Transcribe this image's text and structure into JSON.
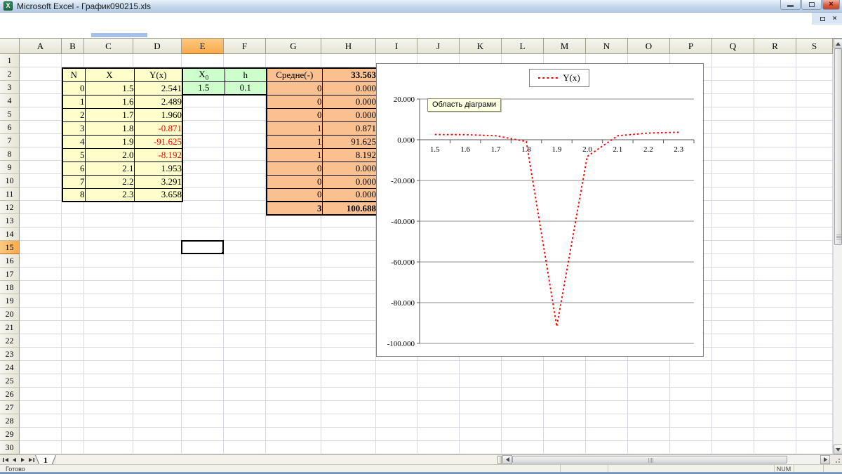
{
  "window": {
    "title": "Microsoft Excel - График090215.xls",
    "controls": {
      "minimize": "minimize",
      "restore": "restore",
      "close": "×"
    },
    "doc_controls": {
      "restore": "restore",
      "close": "×"
    }
  },
  "sheet": {
    "columns": [
      "A",
      "B",
      "C",
      "D",
      "E",
      "F",
      "G",
      "H",
      "I",
      "J",
      "K",
      "L",
      "M",
      "N",
      "O",
      "P",
      "Q",
      "R",
      "S"
    ],
    "row_count": 30,
    "selected_column": "E",
    "selected_row": 15,
    "active_cell": "E15"
  },
  "tables": {
    "main": {
      "headers": [
        "N",
        "X",
        "Y(x)"
      ],
      "rows": [
        [
          "0",
          "1.5",
          "2.541"
        ],
        [
          "1",
          "1.6",
          "2.489"
        ],
        [
          "2",
          "1.7",
          "1.960"
        ],
        [
          "3",
          "1.8",
          "-0.871"
        ],
        [
          "4",
          "1.9",
          "-91.625"
        ],
        [
          "5",
          "2.0",
          "-8.192"
        ],
        [
          "6",
          "2.1",
          "1.953"
        ],
        [
          "7",
          "2.2",
          "3.291"
        ],
        [
          "8",
          "2.3",
          "3.658"
        ]
      ]
    },
    "params": {
      "headers": [
        {
          "text": "X",
          "sub": "0"
        },
        {
          "text": "h",
          "sub": ""
        }
      ],
      "values": [
        "1.5",
        "0.1"
      ]
    },
    "summary": {
      "header": "Средне(-)",
      "header_value": "33.563",
      "rows": [
        [
          "0",
          "0.000"
        ],
        [
          "0",
          "0.000"
        ],
        [
          "0",
          "0.000"
        ],
        [
          "1",
          "0.871"
        ],
        [
          "1",
          "91.625"
        ],
        [
          "1",
          "8.192"
        ],
        [
          "0",
          "0.000"
        ],
        [
          "0",
          "0.000"
        ],
        [
          "0",
          "0.000"
        ]
      ],
      "total": [
        "3",
        "100.688"
      ]
    }
  },
  "chart_data": {
    "type": "line",
    "categories": [
      "1.5",
      "1.6",
      "1.7",
      "1.8",
      "1.9",
      "2.0",
      "2.1",
      "2.2",
      "2.3"
    ],
    "series": [
      {
        "name": "Y(x)",
        "values": [
          2.541,
          2.489,
          1.96,
          -0.871,
          -91.625,
          -8.192,
          1.953,
          3.291,
          3.658
        ],
        "color": "#FF0000",
        "style": "dotted"
      }
    ],
    "ylim": [
      -100,
      20
    ],
    "ytick_step": 20,
    "ytick_labels": [
      "20.000",
      "0.000",
      "-20.000",
      "-40.000",
      "-60.000",
      "-80.000",
      "-100.000"
    ],
    "grid": true,
    "legend": {
      "label": "Y(x)",
      "position": "top"
    },
    "tooltip": "Область діаграми"
  },
  "tab_bar": {
    "tabs": [
      "1"
    ],
    "active_tab": "1"
  },
  "status_bar": {
    "ready": "Готово",
    "num": "NUM"
  },
  "colors": {
    "fill_yellow": "#FFFFCC",
    "fill_green": "#CCFFCC",
    "fill_orange": "#FAC090",
    "negative_text": "#FF0000",
    "series_line": "#FF0000",
    "selected_header": "#F9A94B"
  }
}
